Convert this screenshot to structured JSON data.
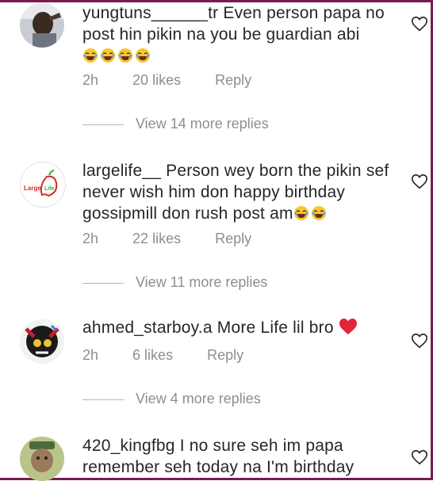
{
  "comments": [
    {
      "username": "yungtuns______tr",
      "text": "Even person papa no post hin pikin na you be guardian abi",
      "emoji_count": 4,
      "time": "2h",
      "likes": "20 likes",
      "reply": "Reply",
      "view_replies": "View 14 more replies"
    },
    {
      "username": "largelife__",
      "text": "Person wey born the pikin sef never wish him don happy birthday gossipmill don rush post am",
      "avatar_logo": "Large Life",
      "time": "2h",
      "likes": "22 likes",
      "reply": "Reply",
      "view_replies": "View 11 more replies"
    },
    {
      "username": "ahmed_starboy.a",
      "text": "More Life lil bro",
      "time": "2h",
      "likes": "6 likes",
      "reply": "Reply",
      "view_replies": "View 4 more replies"
    },
    {
      "username": "420_kingfbg",
      "text": "I no sure seh im papa remember seh today na I'm birthday"
    }
  ],
  "colors": {
    "meta": "#8e8e8e",
    "text": "#262626",
    "frame": "#7a1b4f",
    "heart_red": "#e0243a"
  },
  "icons": {
    "like": "heart-outline-icon",
    "laugh": "laughing-crying-emoji",
    "love": "red-heart-emoji"
  }
}
